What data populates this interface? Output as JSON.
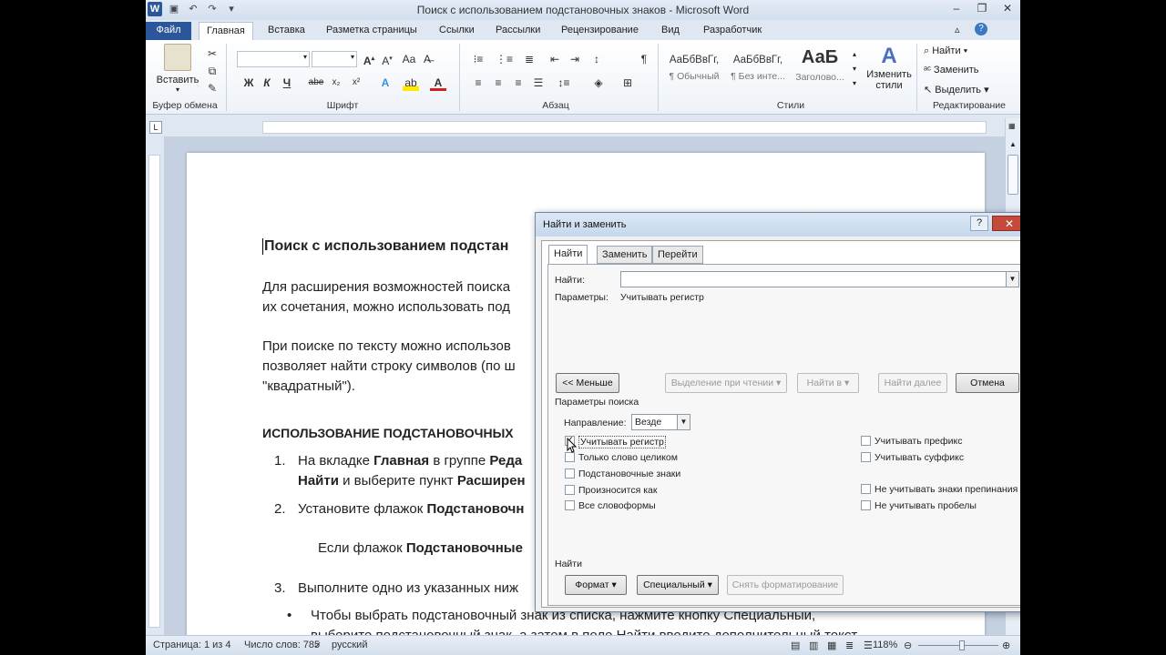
{
  "window": {
    "title": "Поиск с использованием подстановочных знаков - Microsoft Word"
  },
  "tabs": [
    "Файл",
    "Главная",
    "Вставка",
    "Разметка страницы",
    "Ссылки",
    "Рассылки",
    "Рецензирование",
    "Вид",
    "Разработчик"
  ],
  "ribbon": {
    "paste_label": "Вставить",
    "groups": {
      "clipboard": "Буфер обмена",
      "font": "Шрифт",
      "paragraph": "Абзац",
      "styles": "Стили",
      "editing": "Редактирование"
    },
    "styles": [
      {
        "sample": "АаБбВвГг,",
        "name": "¶ Обычный"
      },
      {
        "sample": "АаБбВвГг,",
        "name": "¶ Без инте..."
      },
      {
        "sample": "АаБ",
        "name": "Заголово..."
      }
    ],
    "change_styles": "Изменить стили",
    "find": "Найти",
    "replace": "Заменить",
    "select": "Выделить",
    "font_buttons": [
      "Ж",
      "К",
      "Ч",
      "abe",
      "x₂",
      "x²"
    ]
  },
  "document": {
    "heading": "Поиск с использованием подстан",
    "lines": [
      "Для расширения возможностей поиска",
      "их сочетания, можно использовать под",
      "При поиске по тексту можно использов",
      "позволяет найти строку символов (по ш",
      "\"квадратный\").",
      "ИСПОЛЬЗОВАНИЕ ПОДСТАНОВОЧНЫХ",
      "1.",
      "На вкладке ",
      "Главная",
      " в группе ",
      "Реда",
      "Найти",
      " и выберите пункт ",
      "Расширен",
      "2.",
      "Установите флажок ",
      "Подстановочн",
      "Если флажок ",
      "Подстановочные",
      "3.",
      "Выполните одно из указанных ниж",
      "•",
      "Чтобы выбрать подстановочный знак из списка, нажмите кнопку Специальный,",
      "выберите подстановочный знак, а затем в поле Найти введите дополнительный текст"
    ]
  },
  "statusbar": {
    "page": "Страница: 1 из 4",
    "words": "Число слов: 785",
    "language": "русский",
    "zoom": "118%"
  },
  "dialog": {
    "title": "Найти и заменить",
    "help": "?",
    "close": "✕",
    "tabs": [
      "Найти",
      "Заменить",
      "Перейти"
    ],
    "find_label": "Найти:",
    "find_value": "",
    "params_label": "Параметры:",
    "params_value": "Учитывать регистр",
    "buttons": {
      "less": "<< Меньше",
      "reading_highlight": "Выделение при чтении ▾",
      "find_in": "Найти в ▾",
      "find_next": "Найти далее",
      "cancel": "Отмена",
      "format": "Формат ▾",
      "special": "Специальный ▾",
      "no_format": "Снять форматирование"
    },
    "search_options_label": "Параметры поиска",
    "direction_label": "Направление:",
    "direction_value": "Везде",
    "options_left": [
      {
        "label": "Учитывать регистр",
        "checked": true
      },
      {
        "label": "Только слово целиком",
        "checked": false
      },
      {
        "label": "Подстановочные знаки",
        "checked": false
      },
      {
        "label": "Произносится как",
        "checked": false
      },
      {
        "label": "Все словоформы",
        "checked": false
      }
    ],
    "options_right": [
      {
        "label": "Учитывать префикс",
        "checked": false
      },
      {
        "label": "Учитывать суффикс",
        "checked": false
      },
      {
        "label": "Не учитывать знаки препинания",
        "checked": false
      },
      {
        "label": "Не учитывать пробелы",
        "checked": false
      }
    ],
    "find_section_label": "Найти"
  }
}
